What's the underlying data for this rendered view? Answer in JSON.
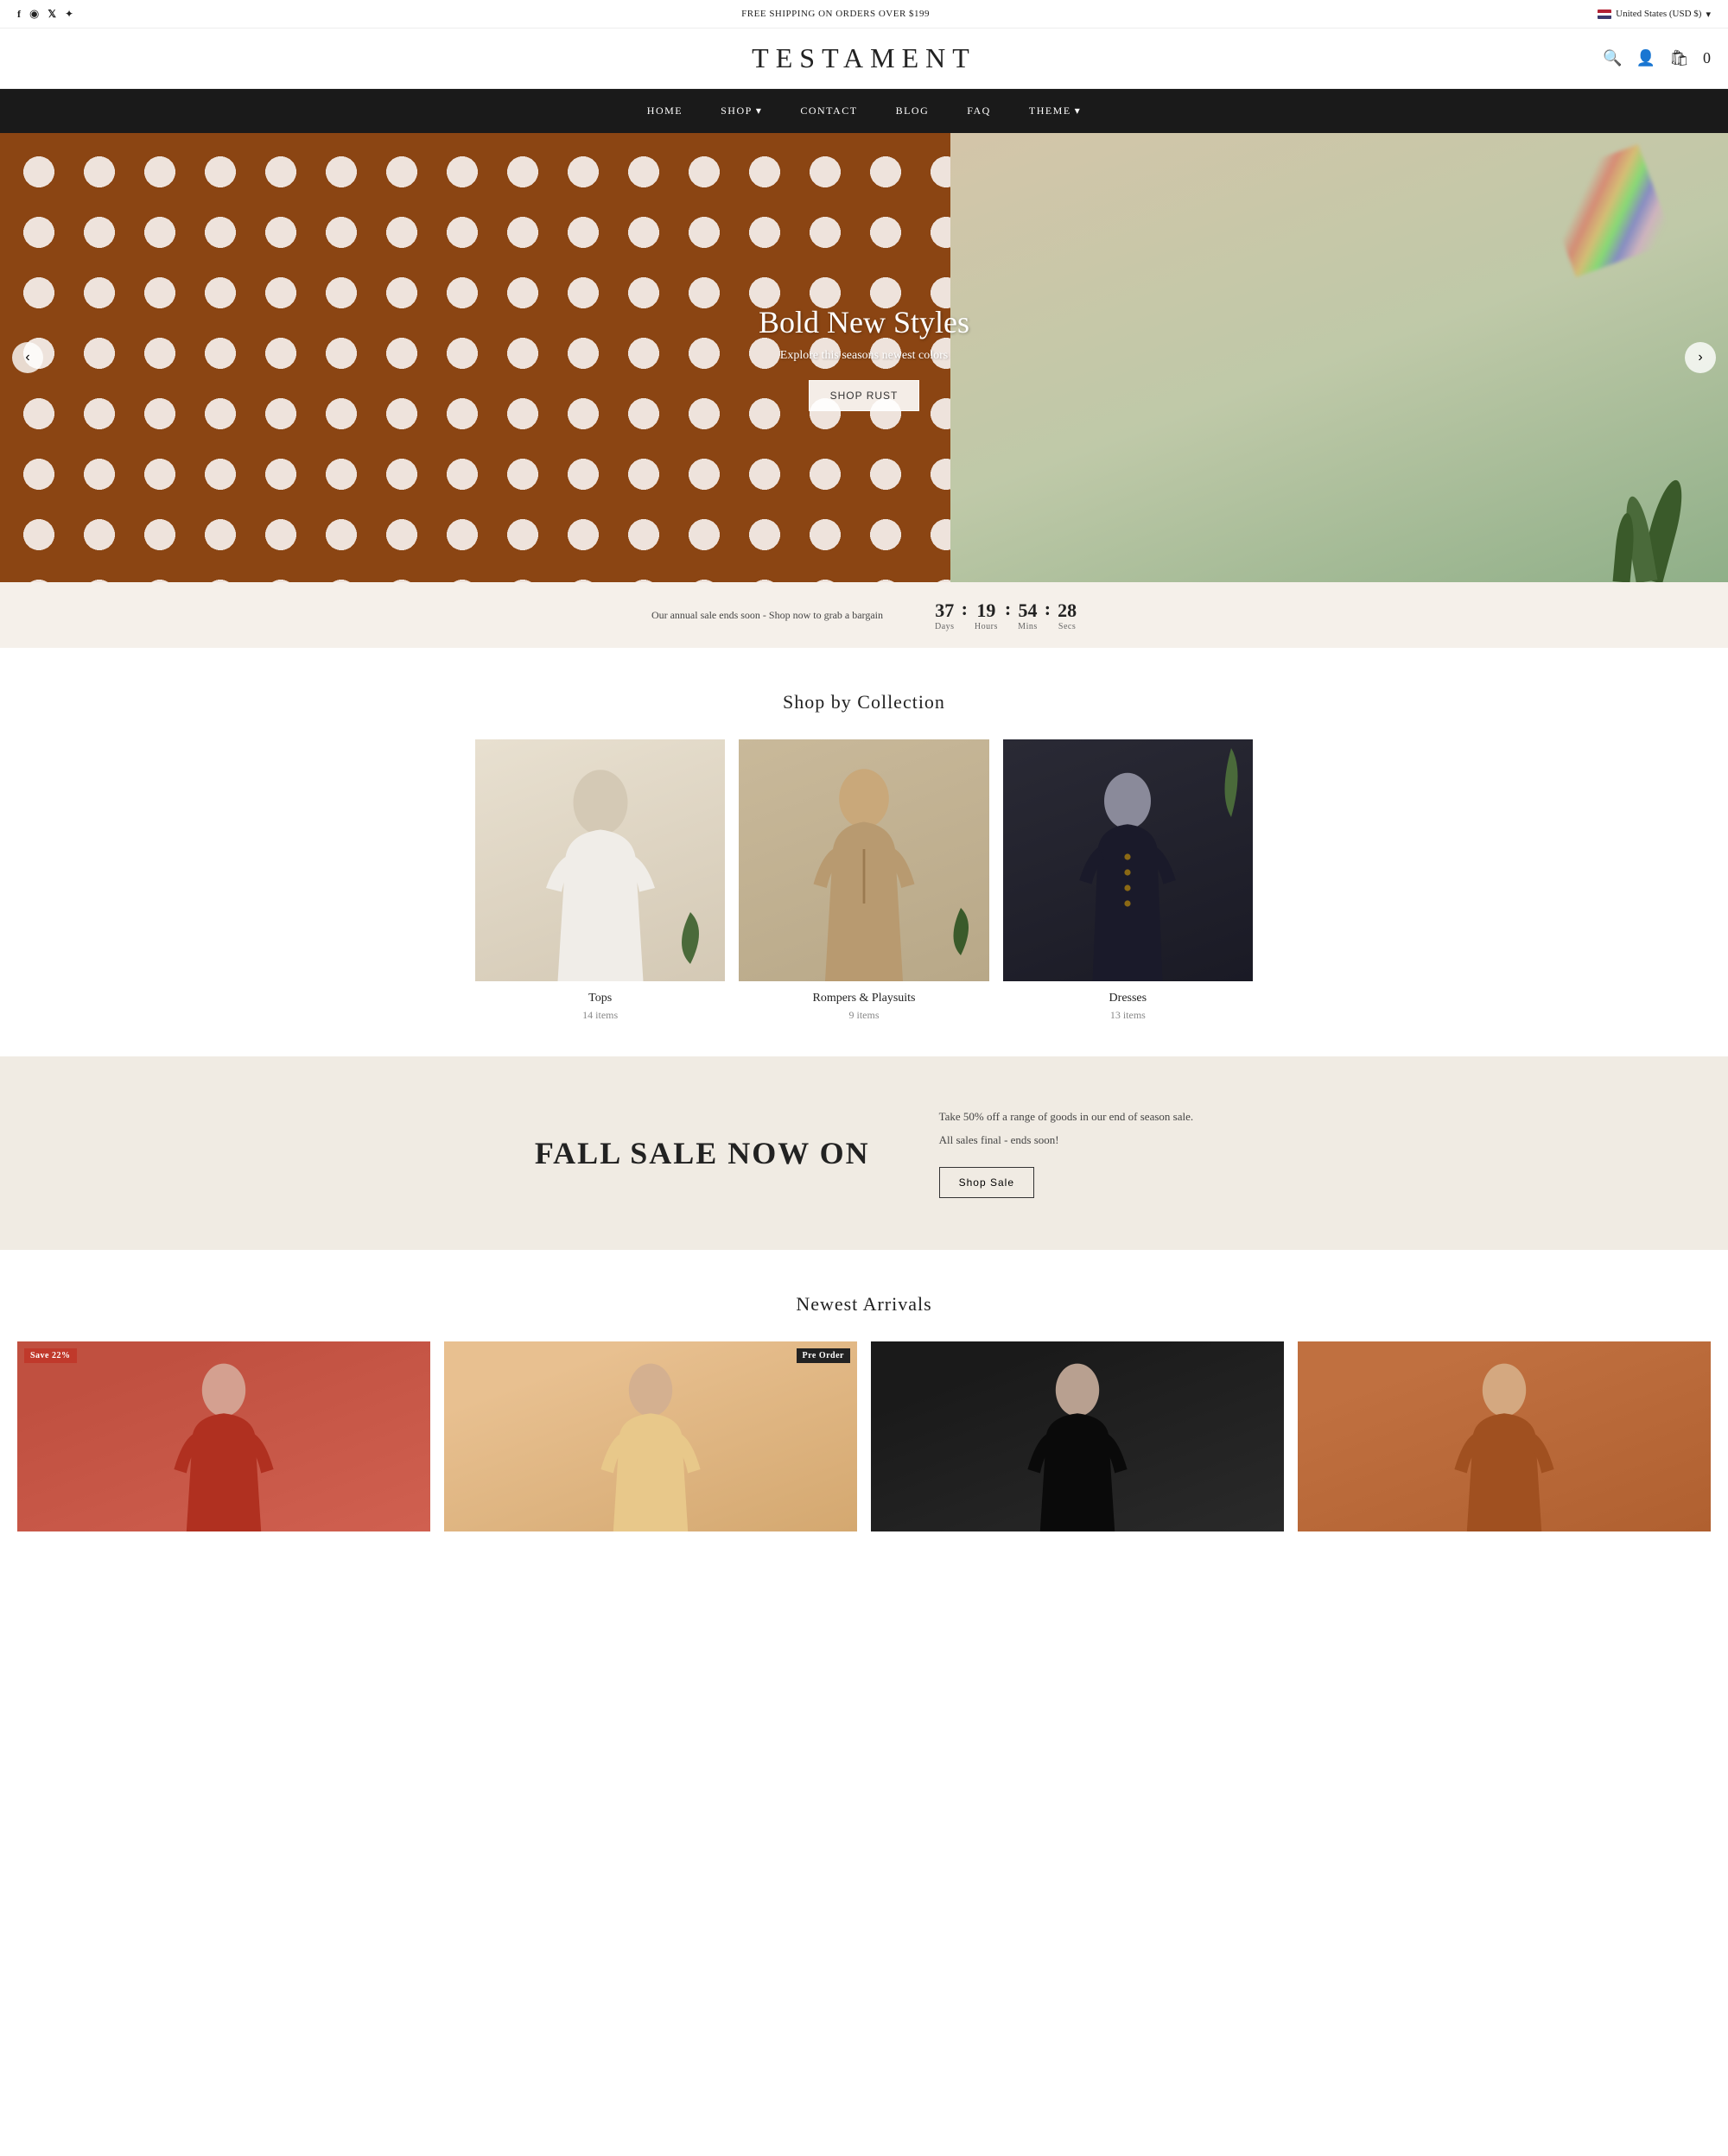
{
  "topbar": {
    "shipping": "FREE SHIPPING ON ORDERS OVER $199",
    "region": "United States (USD $)"
  },
  "header": {
    "logo": "TESTAMENT",
    "cart_count": "0"
  },
  "nav": {
    "items": [
      {
        "label": "HOME",
        "has_dropdown": false
      },
      {
        "label": "SHOP",
        "has_dropdown": true
      },
      {
        "label": "CONTACT",
        "has_dropdown": false
      },
      {
        "label": "BLOG",
        "has_dropdown": false
      },
      {
        "label": "FAQ",
        "has_dropdown": false
      },
      {
        "label": "THEME",
        "has_dropdown": true
      }
    ]
  },
  "hero": {
    "title": "Bold New Styles",
    "subtitle": "Explore this seasons newest colors",
    "button_label": "Shop Rust",
    "prev_label": "‹",
    "next_label": "›"
  },
  "countdown": {
    "text_before": "Our annual sale ends soon -",
    "link_text": "Shop now",
    "text_after": "to grab a bargain",
    "days": "37",
    "hours": "19",
    "mins": "54",
    "secs": "28",
    "labels": {
      "days": "Days",
      "hours": "Hours",
      "mins": "Mins",
      "secs": "Secs"
    },
    "sep": ":"
  },
  "collections": {
    "section_title": "Shop by Collection",
    "items": [
      {
        "name": "Tops",
        "count": "14 items"
      },
      {
        "name": "Rompers & Playsuits",
        "count": "9 items"
      },
      {
        "name": "Dresses",
        "count": "13 items"
      }
    ]
  },
  "fall_sale": {
    "title": "FALL SALE NOW ON",
    "description_1": "Take 50% off a range of goods in our end of season sale.",
    "description_2": "All sales final - ends soon!",
    "button_label": "Shop Sale"
  },
  "arrivals": {
    "section_title": "Newest Arrivals",
    "items": [
      {
        "badge_type": "sale",
        "badge_text": "Save 22%"
      },
      {
        "badge_type": "preorder",
        "badge_text": "Pre Order"
      },
      {
        "badge_type": null,
        "badge_text": ""
      },
      {
        "badge_type": null,
        "badge_text": ""
      }
    ]
  },
  "social": {
    "icons": [
      "f",
      "◉",
      "𝕏",
      "⚲"
    ]
  }
}
